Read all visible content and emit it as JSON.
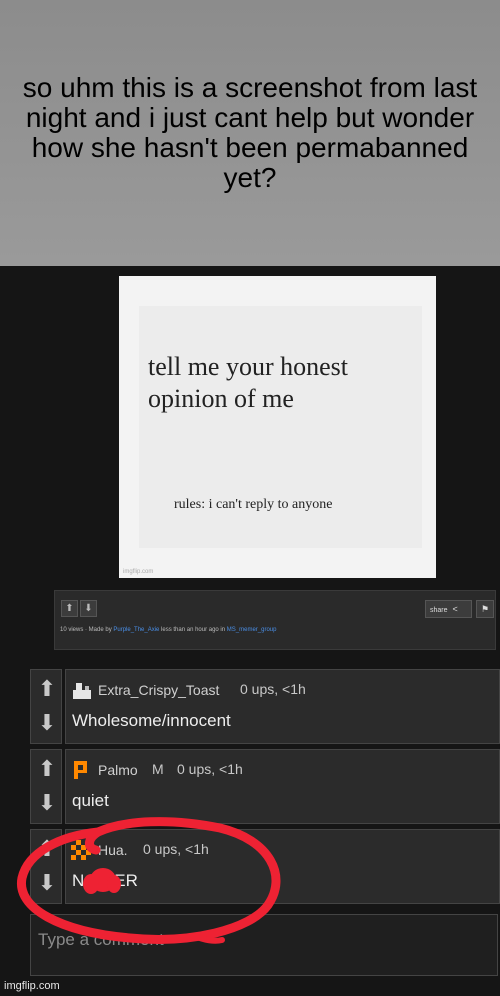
{
  "caption": "so uhm this is a screenshot from last night and i just cant help but wonder how she hasn't been permabanned yet?",
  "meme": {
    "title": "tell me your honest opinion of me",
    "rules": "rules: i can't reply to anyone",
    "watermark": "imgflip.com"
  },
  "info_bar": {
    "share_label": "share",
    "stats_prefix": "10 views · Made by ",
    "author": "Purple_The_Axie",
    "stats_middle": " less than an hour ago in ",
    "group": "MS_memer_group"
  },
  "comments": [
    {
      "username": "Extra_Crispy_Toast",
      "meta": "0 ups, <1h",
      "text": "Wholesome/innocent",
      "badge": ""
    },
    {
      "username": "Palmo",
      "badge": "M",
      "meta": "0 ups, <1h",
      "text": "quiet"
    },
    {
      "username": "Hua.",
      "meta": "0 ups, <1h",
      "text_prefix": "N",
      "text_suffix": "ER",
      "badge": ""
    }
  ],
  "comment_input": {
    "placeholder": "Type a comment"
  },
  "footer": {
    "watermark": "imgflip.com"
  },
  "colors": {
    "link": "#4a8ee6",
    "annotation": "#ee2233",
    "avatar_orange": "#ff8800"
  }
}
